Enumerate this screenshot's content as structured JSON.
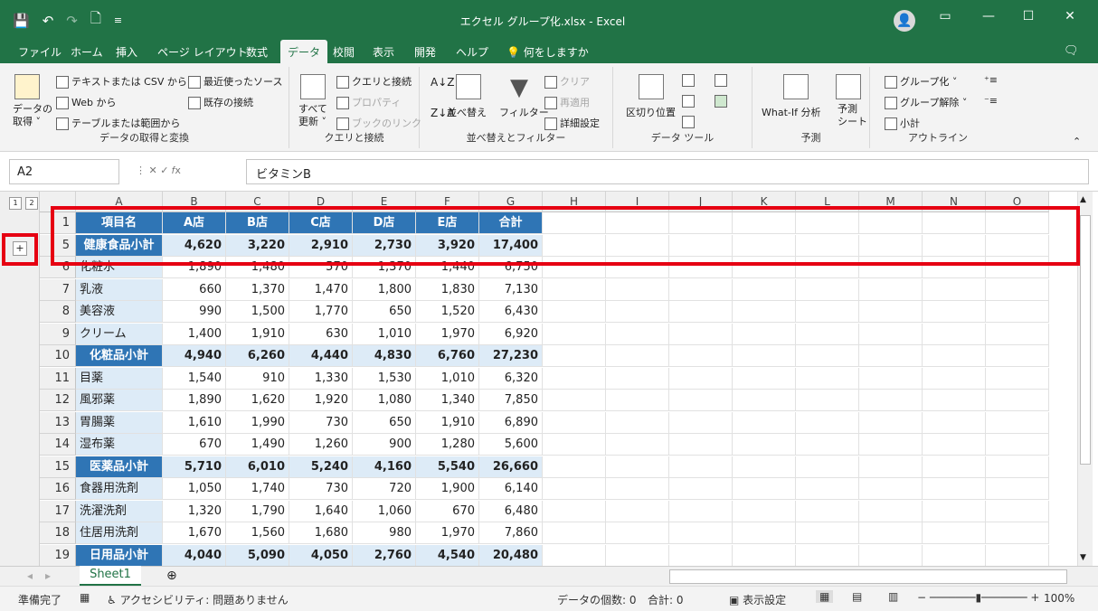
{
  "window": {
    "title": "エクセル グループ化.xlsx  -  Excel"
  },
  "qat": [
    "💾",
    "↶",
    "↷",
    "🗋",
    "≡"
  ],
  "tabs": [
    "ファイル",
    "ホーム",
    "挿入",
    "ページ レイアウト",
    "数式",
    "データ",
    "校閲",
    "表示",
    "開発",
    "ヘルプ",
    "何をしますか"
  ],
  "ribbon": {
    "get_data": {
      "label": "データの取得と変換",
      "get_btn": "データの\n取得 ˅",
      "text_csv": "テキストまたは CSV から",
      "web": "Web から",
      "table_range": "テーブルまたは範囲から",
      "recent": "最近使ったソース",
      "existing": "既存の接続"
    },
    "queries": {
      "label": "クエリと接続",
      "refresh": "すべて\n更新 ˅",
      "qc": "クエリと接続",
      "properties": "プロパティ",
      "links": "ブックのリンク"
    },
    "sort": {
      "label": "並べ替えとフィルター",
      "sort": "並べ替え",
      "filter": "フィルター",
      "clear": "クリア",
      "reapply": "再適用",
      "advanced": "詳細設定"
    },
    "tools": {
      "label": "データ ツール",
      "split": "区切り位置"
    },
    "forecast": {
      "label": "予測",
      "whatif": "What-If 分析",
      "sheet": "予測\nシート"
    },
    "outline": {
      "label": "アウトライン",
      "group": "グループ化",
      "ungroup": "グループ解除",
      "subtotal": "小計"
    }
  },
  "namebox": "A2",
  "formula": "ビタミンB",
  "outline_levels": [
    "1",
    "2"
  ],
  "outline_expand": "+",
  "columns": [
    "A",
    "B",
    "C",
    "D",
    "E",
    "F",
    "G",
    "H",
    "I",
    "J",
    "K",
    "L",
    "M",
    "N",
    "O"
  ],
  "rows": [
    {
      "n": "1",
      "type": "header",
      "cells": [
        "項目名",
        "A店",
        "B店",
        "C店",
        "D店",
        "E店",
        "合計"
      ]
    },
    {
      "n": "5",
      "type": "sub",
      "cells": [
        "健康食品小計",
        "4,620",
        "3,220",
        "2,910",
        "2,730",
        "3,920",
        "17,400"
      ]
    },
    {
      "n": "6",
      "type": "data",
      "cells": [
        "化粧水",
        "1,890",
        "1,480",
        "570",
        "1,370",
        "1,440",
        "6,750"
      ]
    },
    {
      "n": "7",
      "type": "data",
      "cells": [
        "乳液",
        "660",
        "1,370",
        "1,470",
        "1,800",
        "1,830",
        "7,130"
      ]
    },
    {
      "n": "8",
      "type": "data",
      "cells": [
        "美容液",
        "990",
        "1,500",
        "1,770",
        "650",
        "1,520",
        "6,430"
      ]
    },
    {
      "n": "9",
      "type": "data",
      "cells": [
        "クリーム",
        "1,400",
        "1,910",
        "630",
        "1,010",
        "1,970",
        "6,920"
      ]
    },
    {
      "n": "10",
      "type": "sub",
      "cells": [
        "化粧品小計",
        "4,940",
        "6,260",
        "4,440",
        "4,830",
        "6,760",
        "27,230"
      ]
    },
    {
      "n": "11",
      "type": "data",
      "cells": [
        "目薬",
        "1,540",
        "910",
        "1,330",
        "1,530",
        "1,010",
        "6,320"
      ]
    },
    {
      "n": "12",
      "type": "data",
      "cells": [
        "風邪薬",
        "1,890",
        "1,620",
        "1,920",
        "1,080",
        "1,340",
        "7,850"
      ]
    },
    {
      "n": "13",
      "type": "data",
      "cells": [
        "胃腸薬",
        "1,610",
        "1,990",
        "730",
        "650",
        "1,910",
        "6,890"
      ]
    },
    {
      "n": "14",
      "type": "data",
      "cells": [
        "湿布薬",
        "670",
        "1,490",
        "1,260",
        "900",
        "1,280",
        "5,600"
      ]
    },
    {
      "n": "15",
      "type": "sub",
      "cells": [
        "医薬品小計",
        "5,710",
        "6,010",
        "5,240",
        "4,160",
        "5,540",
        "26,660"
      ]
    },
    {
      "n": "16",
      "type": "data",
      "cells": [
        "食器用洗剤",
        "1,050",
        "1,740",
        "730",
        "720",
        "1,900",
        "6,140"
      ]
    },
    {
      "n": "17",
      "type": "data",
      "cells": [
        "洗濯洗剤",
        "1,320",
        "1,790",
        "1,640",
        "1,060",
        "670",
        "6,480"
      ]
    },
    {
      "n": "18",
      "type": "data",
      "cells": [
        "住居用洗剤",
        "1,670",
        "1,560",
        "1,680",
        "980",
        "1,970",
        "7,860"
      ]
    },
    {
      "n": "19",
      "type": "sub",
      "cells": [
        "日用品小計",
        "4,040",
        "5,090",
        "4,050",
        "2,760",
        "4,540",
        "20,480"
      ]
    }
  ],
  "sheet_tab": "Sheet1",
  "status": {
    "ready": "準備完了",
    "accessibility": "アクセシビリティ: 問題ありません",
    "count": "データの個数: 0",
    "sum": "合計: 0",
    "display": "表示設定",
    "zoom": "100%"
  }
}
